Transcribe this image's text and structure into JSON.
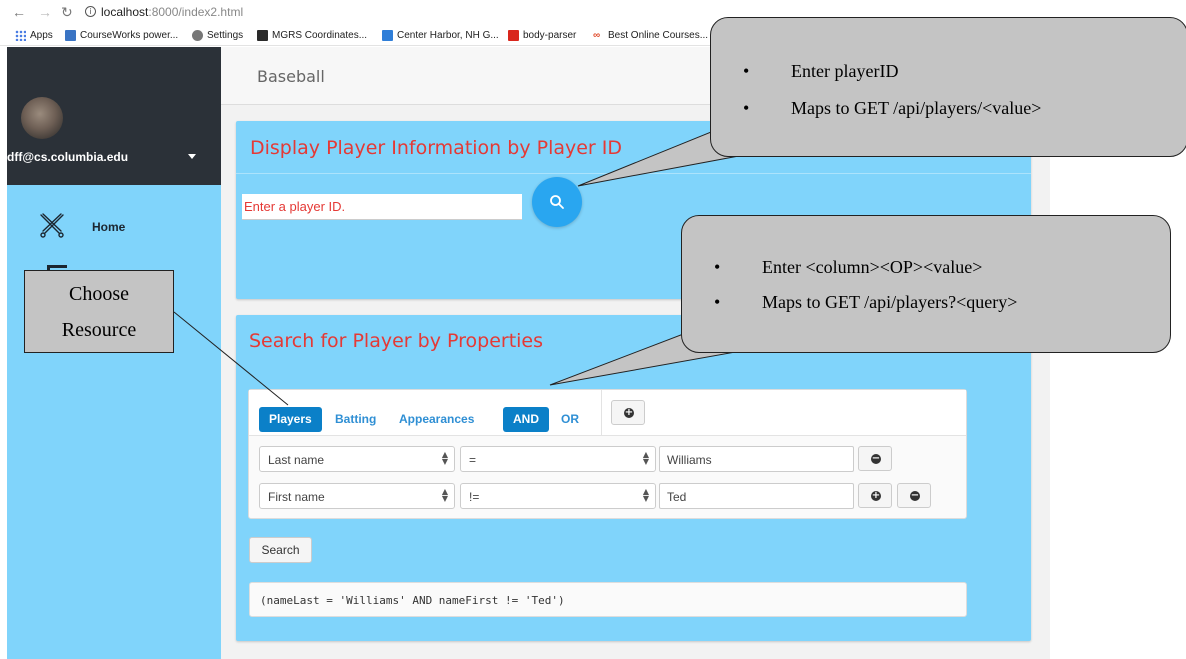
{
  "browser": {
    "back_icon": "arrow-left-icon",
    "forward_icon": "arrow-right-icon",
    "reload_icon": "reload-icon",
    "url_host": "localhost",
    "url_rest": ":8000/index2.html",
    "bookmarks": [
      "Apps",
      "CourseWorks power...",
      "Settings",
      "MGRS Coordinates...",
      "Center Harbor, NH G...",
      "body-parser",
      "Best Online Courses..."
    ]
  },
  "sidebar": {
    "user_email": "dff@cs.columbia.edu",
    "items": [
      {
        "label": "Home",
        "icon": "baseball-bats-icon"
      }
    ]
  },
  "header": {
    "title": "Baseball"
  },
  "player_id_card": {
    "title": "Display Player Information by Player ID",
    "input_placeholder": "Enter a player ID."
  },
  "search_card": {
    "title": "Search for Player by Properties",
    "resource_tabs": [
      "Players",
      "Batting",
      "Appearances"
    ],
    "active_resource": "Players",
    "logic_tabs": [
      "AND",
      "OR"
    ],
    "active_logic": "AND",
    "rules": [
      {
        "column": "Last name",
        "operator": "=",
        "value": "Williams"
      },
      {
        "column": "First name",
        "operator": "!=",
        "value": "Ted"
      }
    ],
    "search_button": "Search",
    "query_text": "(nameLast = 'Williams' AND nameFirst != 'Ted')"
  },
  "annotations": {
    "callout_player_id": [
      "Enter playerID",
      "Maps to GET /api/players/<value>"
    ],
    "callout_query": [
      "Enter <column><OP><value>",
      "Maps to GET /api/players?<query>"
    ],
    "choose_resource": [
      "Choose",
      "Resource"
    ]
  },
  "colors": {
    "card_bg": "#80d4fb",
    "title_red": "#e53935",
    "accent_blue": "#0b80c8",
    "sidebar_dark": "#2b3138"
  }
}
